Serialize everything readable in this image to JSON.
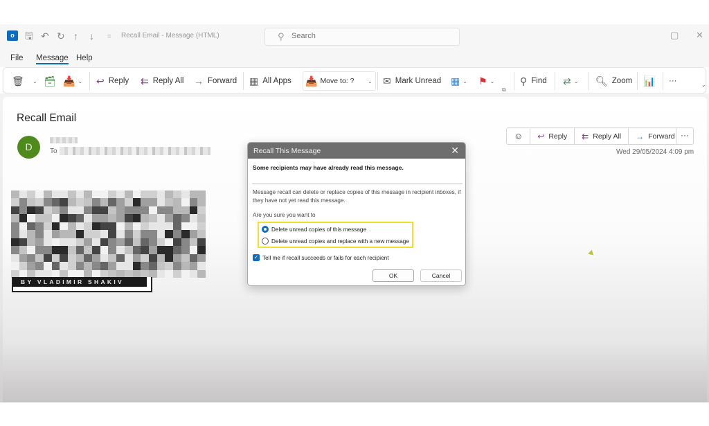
{
  "titlebar": {
    "app_icon": "outlook-logo",
    "app_letter": "o",
    "title": "Recall Email  -  Message (HTML)",
    "search_placeholder": "Search",
    "icons": [
      "save-icon",
      "undo-icon",
      "redo-icon",
      "up-arrow-icon",
      "down-arrow-icon",
      "customize-icon"
    ],
    "restore_icon": "▢",
    "close_icon": "✕"
  },
  "menubar": {
    "items": [
      {
        "label": "File"
      },
      {
        "label": "Message",
        "active": true
      },
      {
        "label": "Help"
      }
    ]
  },
  "ribbon": {
    "reply": "Reply",
    "reply_all": "Reply All",
    "forward": "Forward",
    "all_apps": "All Apps",
    "move_to": "Move to: ?",
    "mark_unread": "Mark Unread",
    "find": "Find",
    "zoom": "Zoom",
    "more": "···"
  },
  "email": {
    "subject": "Recall Email",
    "avatar_initial": "D",
    "to_label": "To",
    "actions": {
      "reply": "Reply",
      "reply_all": "Reply All",
      "forward": "Forward",
      "more": "···"
    },
    "timestamp": "Wed 29/05/2024 4:09 pm",
    "banner_text": "BY VLADIMIR SHAKIV"
  },
  "dialog": {
    "title": "Recall This Message",
    "warning": "Some recipients may have already read this message.",
    "description": "Message recall can delete or replace copies of this message in recipient inboxes, if they have not yet read this message.",
    "question": "Are you sure you want to",
    "options": [
      {
        "label": "Delete unread copies of this message",
        "selected": true
      },
      {
        "label": "Delete unread copies and replace with a new message",
        "selected": false
      }
    ],
    "checkbox_label": "Tell me if recall succeeds or fails for each recipient",
    "checkbox_checked": true,
    "ok": "OK",
    "cancel": "Cancel"
  },
  "colors": {
    "accent": "#0f6cbd",
    "avatar": "#4f8a1c",
    "highlight": "#f0e130",
    "dialog_header": "#6e6e6e"
  }
}
